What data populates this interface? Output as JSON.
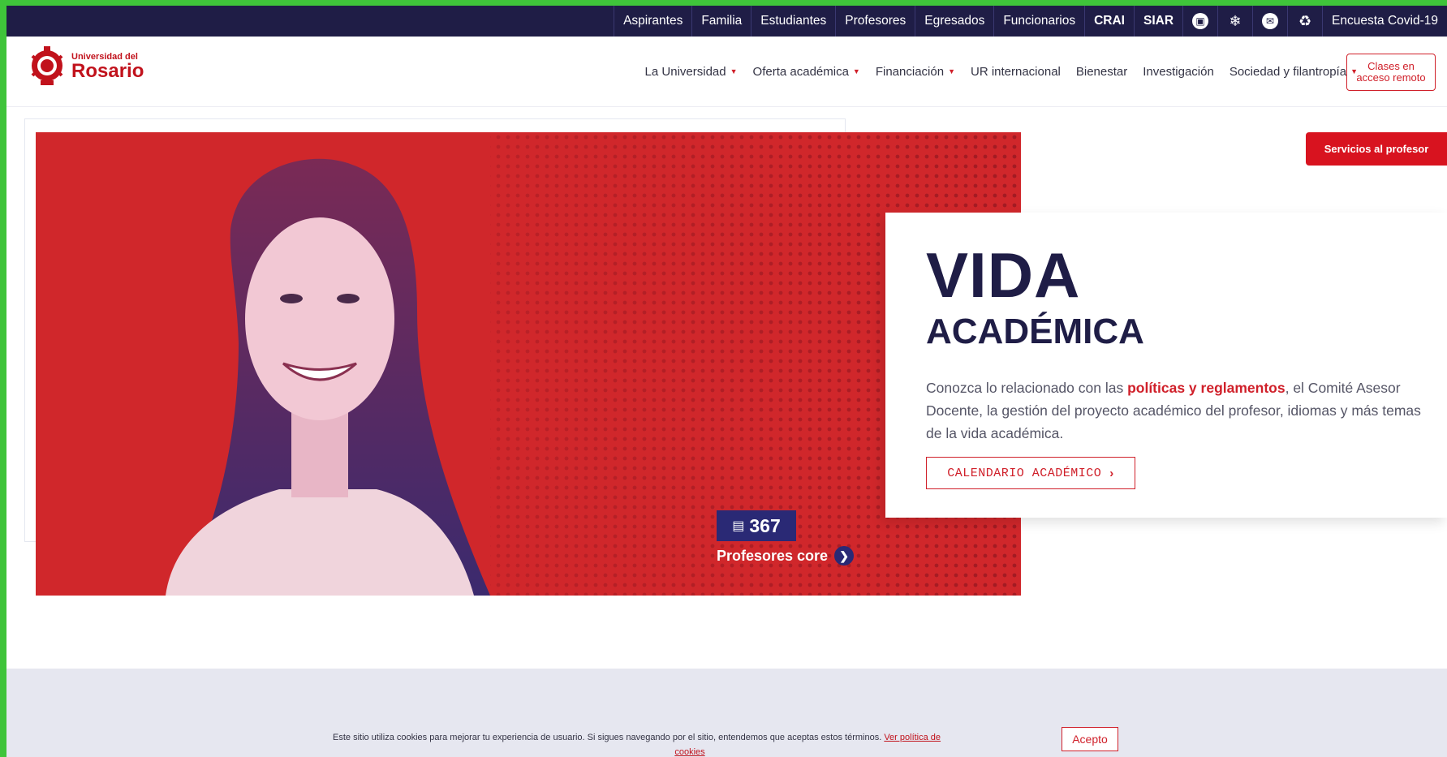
{
  "topbar": {
    "links": [
      "Aspirantes",
      "Familia",
      "Estudiantes",
      "Profesores",
      "Egresados",
      "Funcionarios"
    ],
    "bold_links": [
      "CRAI",
      "SIAR"
    ],
    "icons": [
      "library-icon",
      "network-icon",
      "mail-icon",
      "accessibility-icon"
    ],
    "survey": "Encuesta Covid-19"
  },
  "logo": {
    "line1": "Universidad del",
    "line2": "Rosario"
  },
  "nav": {
    "items": [
      {
        "label": "La Universidad",
        "dropdown": true
      },
      {
        "label": "Oferta académica",
        "dropdown": true
      },
      {
        "label": "Financiación",
        "dropdown": true
      },
      {
        "label": "UR internacional",
        "dropdown": false
      },
      {
        "label": "Bienestar",
        "dropdown": false
      },
      {
        "label": "Investigación",
        "dropdown": false
      },
      {
        "label": "Sociedad y filantropía",
        "dropdown": true
      }
    ],
    "remote_button_line1": "Clases en",
    "remote_button_line2": "acceso remoto"
  },
  "hero": {
    "stat_value": "367",
    "stat_label": "Profesores core",
    "service_button": "Servicios al profesor"
  },
  "info": {
    "title1": "VIDA",
    "title2": "ACADÉMICA",
    "desc_before": "Conozca lo relacionado con las ",
    "desc_highlight": "políticas y reglamentos",
    "desc_after": ", el Comité Asesor Docente, la gestión del proyecto académico del profesor, idiomas y más temas de la vida académica.",
    "button": "CALENDARIO ACADÉMICO"
  },
  "cookies": {
    "text": "Este sitio utiliza cookies para mejorar tu experiencia de usuario. Si sigues navegando por el sitio, entendemos que aceptas estos términos. ",
    "link_part1": "Ver política de",
    "link_part2": "cookies",
    "accept": "Acepto"
  },
  "colors": {
    "navy": "#1f1d46",
    "red": "#d0272b",
    "accent_red": "#d8131f",
    "stat_blue": "#2a2975"
  }
}
